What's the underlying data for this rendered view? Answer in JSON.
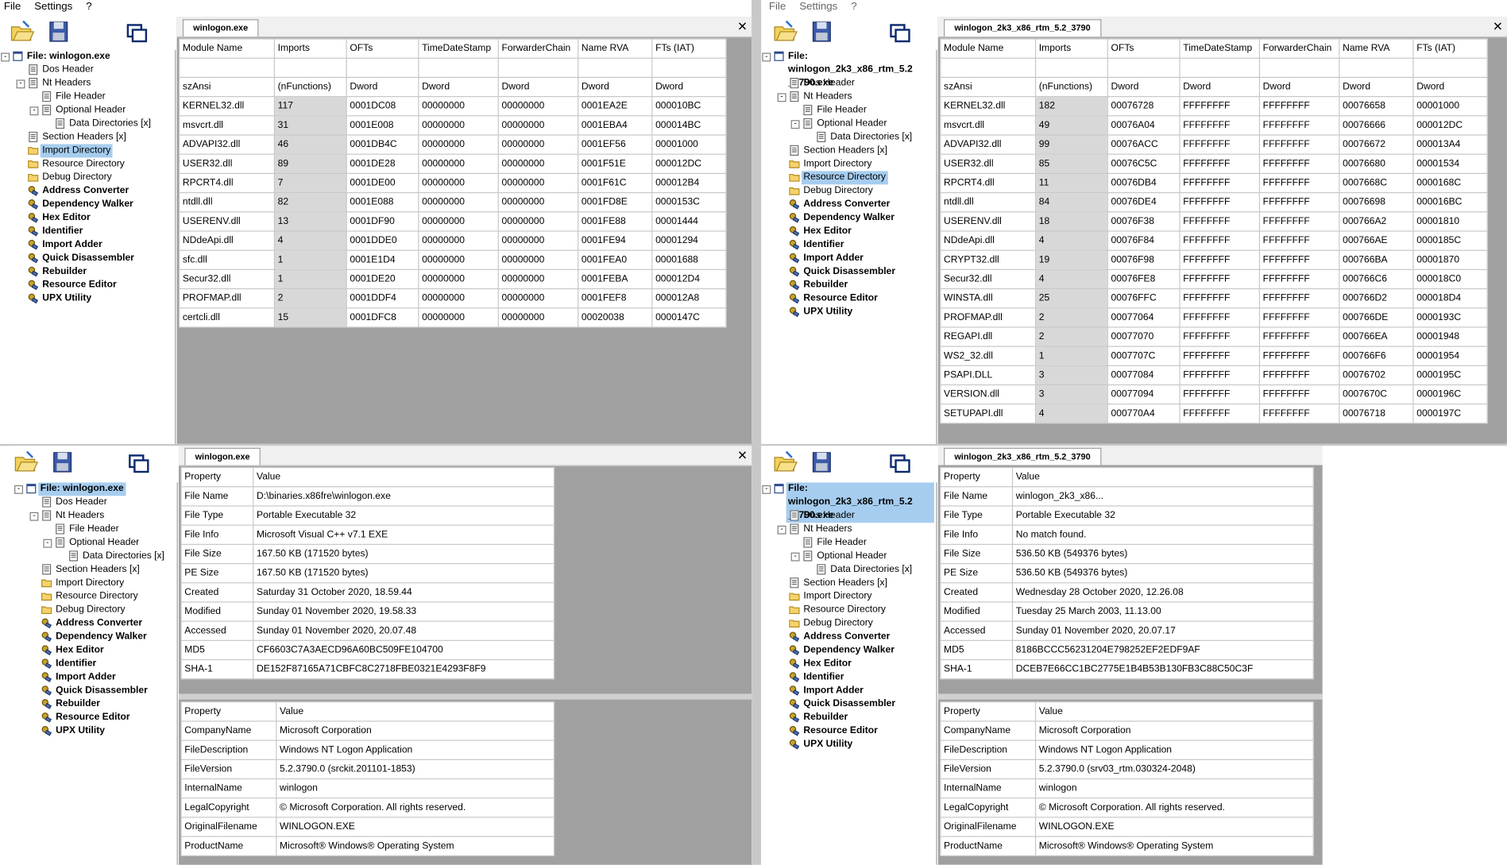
{
  "menu": [
    "File",
    "Settings",
    "?"
  ],
  "tree": [
    {
      "label": "File: winlogon.exe",
      "level": 0,
      "icon": "file",
      "exp": "-",
      "bold": true
    },
    {
      "label": "Dos Header",
      "level": 1,
      "icon": "doc"
    },
    {
      "label": "Nt Headers",
      "level": 1,
      "icon": "doc",
      "exp": "-"
    },
    {
      "label": "File Header",
      "level": 2,
      "icon": "doc"
    },
    {
      "label": "Optional Header",
      "level": 2,
      "icon": "doc",
      "exp": "-"
    },
    {
      "label": "Data Directories [x]",
      "level": 3,
      "icon": "doc"
    },
    {
      "label": "Section Headers [x]",
      "level": 1,
      "icon": "doc"
    },
    {
      "label": "Import Directory",
      "level": 1,
      "icon": "folder"
    },
    {
      "label": "Resource Directory",
      "level": 1,
      "icon": "folder"
    },
    {
      "label": "Debug Directory",
      "level": 1,
      "icon": "folder"
    },
    {
      "label": "Address Converter",
      "level": 1,
      "icon": "tool",
      "bold": true
    },
    {
      "label": "Dependency Walker",
      "level": 1,
      "icon": "tool",
      "bold": true
    },
    {
      "label": "Hex Editor",
      "level": 1,
      "icon": "tool",
      "bold": true
    },
    {
      "label": "Identifier",
      "level": 1,
      "icon": "tool",
      "bold": true
    },
    {
      "label": "Import Adder",
      "level": 1,
      "icon": "tool",
      "bold": true
    },
    {
      "label": "Quick Disassembler",
      "level": 1,
      "icon": "tool",
      "bold": true
    },
    {
      "label": "Rebuilder",
      "level": 1,
      "icon": "tool",
      "bold": true
    },
    {
      "label": "Resource Editor",
      "level": 1,
      "icon": "tool",
      "bold": true
    },
    {
      "label": "UPX Utility",
      "level": 1,
      "icon": "tool",
      "bold": true
    }
  ],
  "file_label_right_line1": "File: winlogon_2k3_x86_rtm_5.2",
  "file_label_right_line2": "_3790.exe",
  "import_headers": [
    "Module Name",
    "Imports",
    "OFTs",
    "TimeDateStamp",
    "ForwarderChain",
    "Name RVA",
    "FTs (IAT)"
  ],
  "import_types": [
    "szAnsi",
    "(nFunctions)",
    "Dword",
    "Dword",
    "Dword",
    "Dword",
    "Dword"
  ],
  "panels": {
    "tl": {
      "tab": "winlogon.exe",
      "selected": 7,
      "rows": [
        [
          "KERNEL32.dll",
          "117",
          "0001DC08",
          "00000000",
          "00000000",
          "0001EA2E",
          "000010BC"
        ],
        [
          "msvcrt.dll",
          "31",
          "0001E008",
          "00000000",
          "00000000",
          "0001EBA4",
          "000014BC"
        ],
        [
          "ADVAPI32.dll",
          "46",
          "0001DB4C",
          "00000000",
          "00000000",
          "0001EF56",
          "00001000"
        ],
        [
          "USER32.dll",
          "89",
          "0001DE28",
          "00000000",
          "00000000",
          "0001F51E",
          "000012DC"
        ],
        [
          "RPCRT4.dll",
          "7",
          "0001DE00",
          "00000000",
          "00000000",
          "0001F61C",
          "000012B4"
        ],
        [
          "ntdll.dll",
          "82",
          "0001E088",
          "00000000",
          "00000000",
          "0001FD8E",
          "0000153C"
        ],
        [
          "USERENV.dll",
          "13",
          "0001DF90",
          "00000000",
          "00000000",
          "0001FE88",
          "00001444"
        ],
        [
          "NDdeApi.dll",
          "4",
          "0001DDE0",
          "00000000",
          "00000000",
          "0001FE94",
          "00001294"
        ],
        [
          "sfc.dll",
          "1",
          "0001E1D4",
          "00000000",
          "00000000",
          "0001FEA0",
          "00001688"
        ],
        [
          "Secur32.dll",
          "1",
          "0001DE20",
          "00000000",
          "00000000",
          "0001FEBA",
          "000012D4"
        ],
        [
          "PROFMAP.dll",
          "2",
          "0001DDF4",
          "00000000",
          "00000000",
          "0001FEF8",
          "000012A8"
        ],
        [
          "certcli.dll",
          "15",
          "0001DFC8",
          "00000000",
          "00000000",
          "00020038",
          "0000147C"
        ]
      ]
    },
    "tr": {
      "tab": "winlogon_2k3_x86_rtm_5.2_3790",
      "selected": 8,
      "rows": [
        [
          "KERNEL32.dll",
          "182",
          "00076728",
          "FFFFFFFF",
          "FFFFFFFF",
          "00076658",
          "00001000"
        ],
        [
          "msvcrt.dll",
          "49",
          "00076A04",
          "FFFFFFFF",
          "FFFFFFFF",
          "00076666",
          "000012DC"
        ],
        [
          "ADVAPI32.dll",
          "99",
          "00076ACC",
          "FFFFFFFF",
          "FFFFFFFF",
          "00076672",
          "000013A4"
        ],
        [
          "USER32.dll",
          "85",
          "00076C5C",
          "FFFFFFFF",
          "FFFFFFFF",
          "00076680",
          "00001534"
        ],
        [
          "RPCRT4.dll",
          "11",
          "00076DB4",
          "FFFFFFFF",
          "FFFFFFFF",
          "0007668C",
          "0000168C"
        ],
        [
          "ntdll.dll",
          "84",
          "00076DE4",
          "FFFFFFFF",
          "FFFFFFFF",
          "00076698",
          "000016BC"
        ],
        [
          "USERENV.dll",
          "18",
          "00076F38",
          "FFFFFFFF",
          "FFFFFFFF",
          "000766A2",
          "00001810"
        ],
        [
          "NDdeApi.dll",
          "4",
          "00076F84",
          "FFFFFFFF",
          "FFFFFFFF",
          "000766AE",
          "0000185C"
        ],
        [
          "CRYPT32.dll",
          "19",
          "00076F98",
          "FFFFFFFF",
          "FFFFFFFF",
          "000766BA",
          "00001870"
        ],
        [
          "Secur32.dll",
          "4",
          "00076FE8",
          "FFFFFFFF",
          "FFFFFFFF",
          "000766C6",
          "000018C0"
        ],
        [
          "WINSTA.dll",
          "25",
          "00076FFC",
          "FFFFFFFF",
          "FFFFFFFF",
          "000766D2",
          "000018D4"
        ],
        [
          "PROFMAP.dll",
          "2",
          "00077064",
          "FFFFFFFF",
          "FFFFFFFF",
          "000766DE",
          "0000193C"
        ],
        [
          "REGAPI.dll",
          "2",
          "00077070",
          "FFFFFFFF",
          "FFFFFFFF",
          "000766EA",
          "00001948"
        ],
        [
          "WS2_32.dll",
          "1",
          "0007707C",
          "FFFFFFFF",
          "FFFFFFFF",
          "000766F6",
          "00001954"
        ],
        [
          "PSAPI.DLL",
          "3",
          "00077084",
          "FFFFFFFF",
          "FFFFFFFF",
          "00076702",
          "0000195C"
        ],
        [
          "VERSION.dll",
          "3",
          "00077094",
          "FFFFFFFF",
          "FFFFFFFF",
          "0007670C",
          "0000196C"
        ],
        [
          "SETUPAPI.dll",
          "4",
          "000770A4",
          "FFFFFFFF",
          "FFFFFFFF",
          "00076718",
          "0000197C"
        ]
      ]
    },
    "bl": {
      "tab": "winlogon.exe",
      "selected": 0,
      "props_header": [
        "Property",
        "Value"
      ],
      "props": [
        [
          "File Name",
          "D:\\binaries.x86fre\\winlogon.exe"
        ],
        [
          "File Type",
          "Portable Executable 32"
        ],
        [
          "File Info",
          "Microsoft Visual C++ v7.1 EXE"
        ],
        [
          "File Size",
          "167.50 KB (171520 bytes)"
        ],
        [
          "PE Size",
          "167.50 KB (171520 bytes)"
        ],
        [
          "Created",
          "Saturday 31 October 2020, 18.59.44"
        ],
        [
          "Modified",
          "Sunday 01 November 2020, 19.58.33"
        ],
        [
          "Accessed",
          "Sunday 01 November 2020, 20.07.48"
        ],
        [
          "MD5",
          "CF6603C7A3AECD96A60BC509FE104700"
        ],
        [
          "SHA-1",
          "DE152F87165A71CBFC8C2718FBE0321E4293F8F9"
        ]
      ],
      "ver": [
        [
          "CompanyName",
          "Microsoft Corporation"
        ],
        [
          "FileDescription",
          "Windows NT Logon Application"
        ],
        [
          "FileVersion",
          "5.2.3790.0 (srckit.201101-1853)"
        ],
        [
          "InternalName",
          "winlogon"
        ],
        [
          "LegalCopyright",
          "© Microsoft Corporation. All rights reserved."
        ],
        [
          "OriginalFilename",
          "WINLOGON.EXE"
        ],
        [
          "ProductName",
          "Microsoft® Windows® Operating System"
        ]
      ]
    },
    "br": {
      "tab": "winlogon_2k3_x86_rtm_5.2_3790",
      "selected": 0,
      "props_header": [
        "Property",
        "Value"
      ],
      "props": [
        [
          "File Name",
          "winlogon_2k3_x86..."
        ],
        [
          "File Type",
          "Portable Executable 32"
        ],
        [
          "File Info",
          "No match found."
        ],
        [
          "File Size",
          "536.50 KB (549376 bytes)"
        ],
        [
          "PE Size",
          "536.50 KB (549376 bytes)"
        ],
        [
          "Created",
          "Wednesday 28 October 2020, 12.26.08"
        ],
        [
          "Modified",
          "Tuesday 25 March 2003, 11.13.00"
        ],
        [
          "Accessed",
          "Sunday 01 November 2020, 20.07.17"
        ],
        [
          "MD5",
          "8186BCCC56231204E798252EF2EDF9AF"
        ],
        [
          "SHA-1",
          "DCEB7E66CC1BC2775E1B4B53B130FB3C88C50C3F"
        ]
      ],
      "ver": [
        [
          "CompanyName",
          "Microsoft Corporation"
        ],
        [
          "FileDescription",
          "Windows NT Logon Application"
        ],
        [
          "FileVersion",
          "5.2.3790.0 (srv03_rtm.030324-2048)"
        ],
        [
          "InternalName",
          "winlogon"
        ],
        [
          "LegalCopyright",
          "© Microsoft Corporation. All rights reserved."
        ],
        [
          "OriginalFilename",
          "WINLOGON.EXE"
        ],
        [
          "ProductName",
          "Microsoft® Windows® Operating System"
        ]
      ]
    }
  }
}
